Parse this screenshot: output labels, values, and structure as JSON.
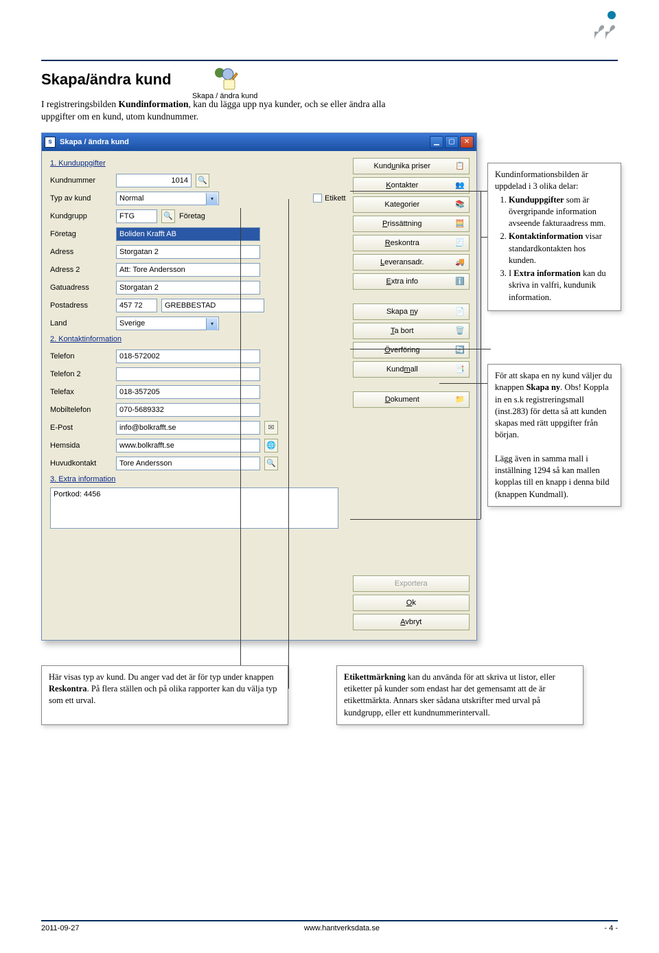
{
  "heading": "Skapa/ändra kund",
  "icon_caption": "Skapa / ändra kund",
  "intro": {
    "pre": "I registreringsbilden ",
    "bold1": "Kundinformation",
    "post": ", kan du lägga upp nya kunder, och se eller ändra alla uppgifter om en kund, utom kundnummer."
  },
  "window": {
    "title": "Skapa / ändra kund",
    "sections": {
      "s1": "1. Kunduppgifter",
      "s2": "2. Kontaktinformation",
      "s3": "3. Extra information"
    },
    "labels": {
      "kundnummer": "Kundnummer",
      "typavkund": "Typ av kund",
      "kundgrupp": "Kundgrupp",
      "foretag_lbl": "Företag",
      "adress": "Adress",
      "adress2": "Adress 2",
      "gatuadress": "Gatuadress",
      "postadress": "Postadress",
      "land": "Land",
      "telefon": "Telefon",
      "telefon2": "Telefon 2",
      "telefax": "Telefax",
      "mobil": "Mobiltelefon",
      "epost": "E-Post",
      "hemsida": "Hemsida",
      "huvudkontakt": "Huvudkontakt",
      "etikett": "Etikett"
    },
    "values": {
      "kundnummer": "1014",
      "typavkund": "Normal",
      "kundgrupp_code": "FTG",
      "kundgrupp_text": "Företag",
      "foretag": "Boliden Krafft AB",
      "adress": "Storgatan 2",
      "adress2": "Att: Tore Andersson",
      "gatuadress": "Storgatan 2",
      "postnr": "457 72",
      "postort": "GREBBESTAD",
      "land": "Sverige",
      "telefon": "018-572002",
      "telefon2": "",
      "telefax": "018-357205",
      "mobil": "070-5689332",
      "epost": "info@bolkrafft.se",
      "hemsida": "www.bolkrafft.se",
      "huvudkontakt": "Tore Andersson",
      "extra": "Portkod: 4456"
    },
    "sidebuttons": [
      {
        "label": "Kundunika priser",
        "u": "u"
      },
      {
        "label": "Kontakter",
        "u": "K"
      },
      {
        "label": "Kategorier",
        "u": "g"
      },
      {
        "label": "Prissättning",
        "u": "P"
      },
      {
        "label": "Reskontra",
        "u": "R"
      },
      {
        "label": "Leveransadr.",
        "u": "L"
      },
      {
        "label": "Extra info",
        "u": "E"
      }
    ],
    "sidebuttons2": [
      {
        "label": "Skapa ny",
        "u": "n"
      },
      {
        "label": "Ta bort",
        "u": "T"
      },
      {
        "label": "Överföring",
        "u": "Ö"
      },
      {
        "label": "Kundmall",
        "u": "m"
      },
      {
        "label": "Dokument",
        "u": "D"
      }
    ],
    "sidebuttons3": [
      {
        "label": "Exportera",
        "disabled": true
      },
      {
        "label": "Ok",
        "u": "O"
      },
      {
        "label": "Avbryt",
        "u": "A"
      }
    ]
  },
  "callouts": {
    "c1": {
      "lead": "Kundinformationsbilden är uppdelad i 3 olika delar:",
      "items": [
        {
          "b": "Kunduppgifter",
          "t": " som är övergripande information avseende fakturaadress mm."
        },
        {
          "b": "Kontaktinformation",
          "t": " visar standardkontakten hos kunden."
        },
        {
          "b_pre": "I ",
          "b": "Extra information",
          "t": " kan du skriva in valfri, kundunik information."
        }
      ]
    },
    "c2": {
      "p1_pre": "För att skapa en ny kund väljer du knappen ",
      "p1_b": "Skapa ny",
      "p1_post": ". Obs! Koppla in en s.k registreringsmall (inst.283) för detta så att kunden skapas med rätt uppgifter från början.",
      "p2": "Lägg även in samma mall i inställning 1294 så kan mallen kopplas till en knapp i denna bild (knappen Kundmall)."
    },
    "c3": {
      "p_pre": "Här visas typ av kund. Du anger vad det är för typ under knappen ",
      "p_b": "Reskontra",
      "p_post": ". På flera ställen och på olika rapporter kan du välja typ som ett urval."
    },
    "c4": {
      "p_b": "Etikettmärkning",
      "p_post": " kan du använda för att skriva ut listor, eller etiketter på kunder som endast har det gemensamt att de är etikettmärkta. Annars sker sådana utskrifter med urval på kundgrupp, eller ett kundnummerintervall."
    }
  },
  "footer": {
    "date": "2011-09-27",
    "url": "www.hantverksdata.se",
    "page": "- 4 -"
  }
}
